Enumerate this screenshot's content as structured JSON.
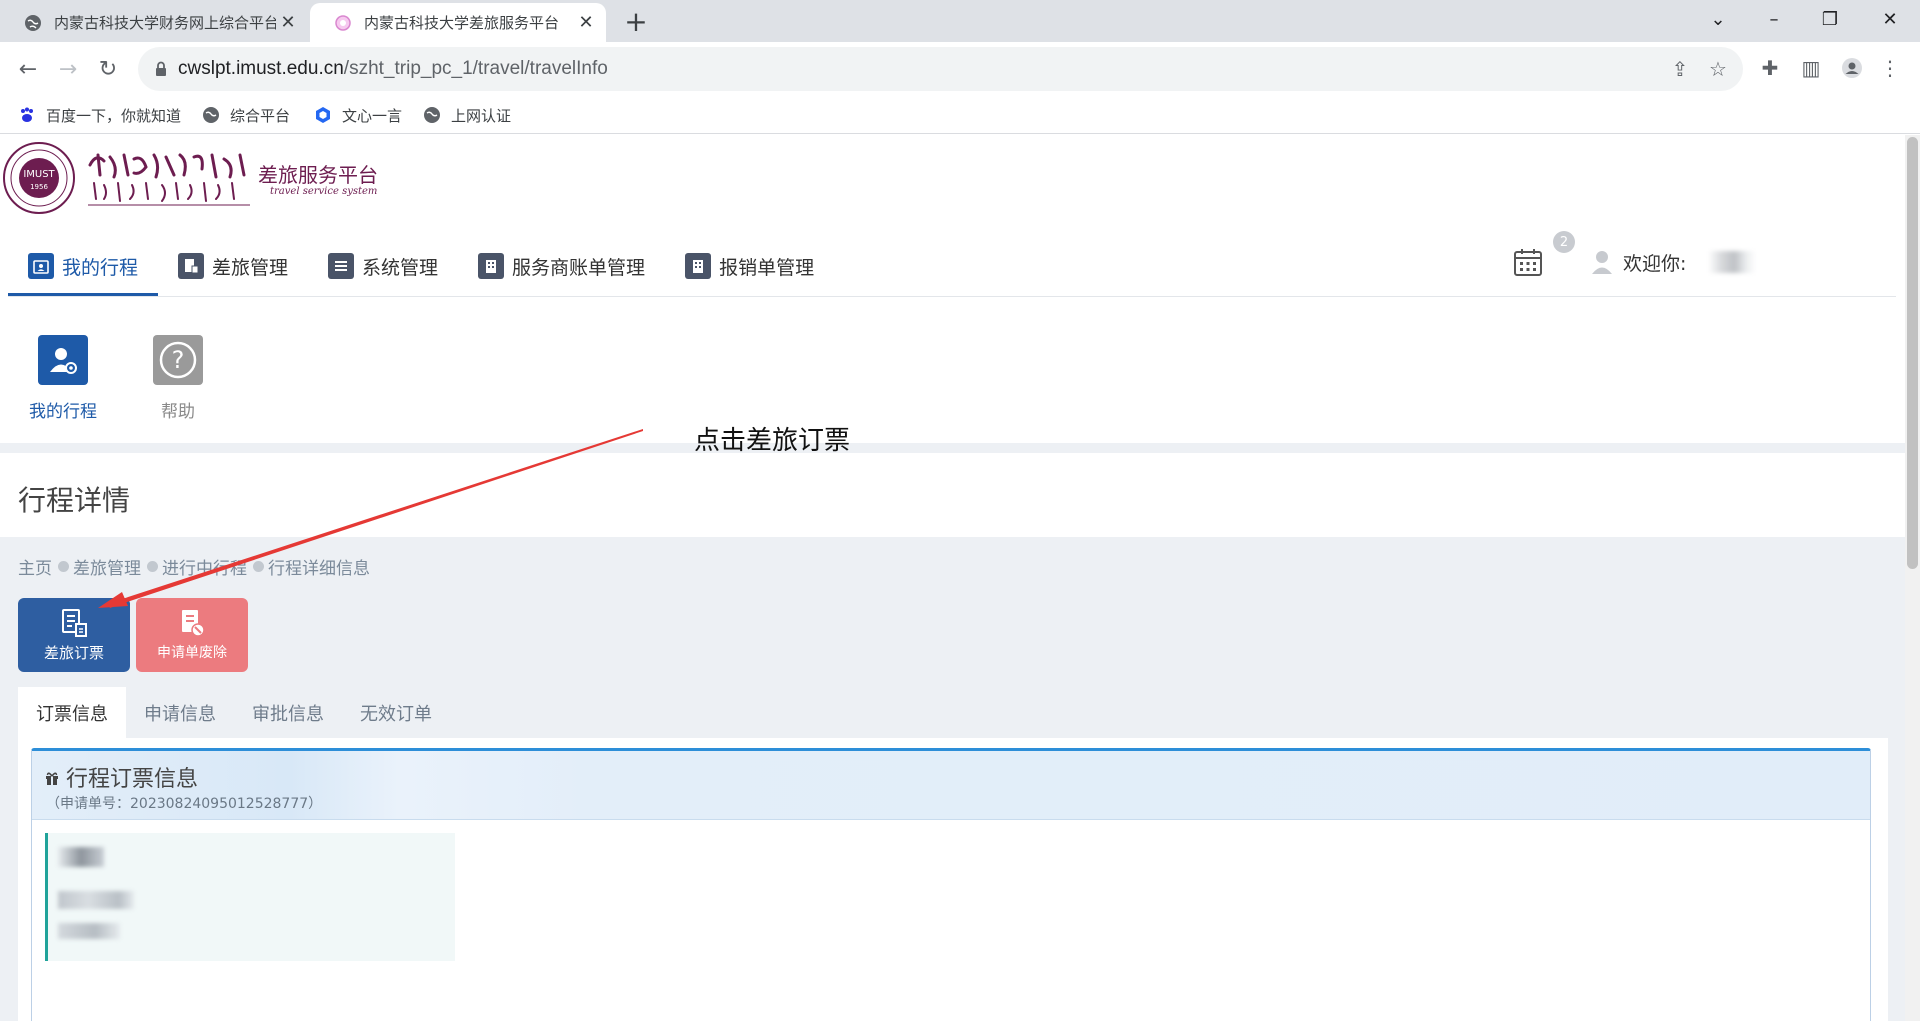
{
  "browser": {
    "tabs": [
      {
        "title": "内蒙古科技大学财务网上综合平台",
        "active": false
      },
      {
        "title": "内蒙古科技大学差旅服务平台",
        "active": true
      }
    ],
    "url_host": "cwslpt.imust.edu.cn",
    "url_path": "/szht_trip_pc_1/travel/travelInfo",
    "bookmarks": [
      "百度一下，你就知道",
      "综合平台",
      "文心一言",
      "上网认证"
    ]
  },
  "site": {
    "title": "差旅服务平台",
    "subtitle": "travel service system"
  },
  "nav": {
    "items": [
      "我的行程",
      "差旅管理",
      "系统管理",
      "服务商账单管理",
      "报销单管理"
    ],
    "active": "我的行程",
    "notification_count": "2",
    "welcome": "欢迎你:"
  },
  "quick_links": [
    {
      "label": "我的行程",
      "color": "#1e5aa8"
    },
    {
      "label": "帮助",
      "color": "#9a9a9a"
    }
  ],
  "page": {
    "title": "行程详情",
    "breadcrumbs": [
      "主页",
      "差旅管理",
      "进行中行程",
      "行程详细信息"
    ],
    "actions": {
      "book_label": "差旅订票",
      "void_label": "申请单废除"
    },
    "tabs": [
      "订票信息",
      "申请信息",
      "审批信息",
      "无效订单"
    ],
    "active_tab": "订票信息",
    "panel": {
      "title": "行程订票信息",
      "request_no": "（申请单号：20230824095012528777）"
    }
  },
  "annotation": {
    "text": "点击差旅订票",
    "color": "#e53935"
  }
}
